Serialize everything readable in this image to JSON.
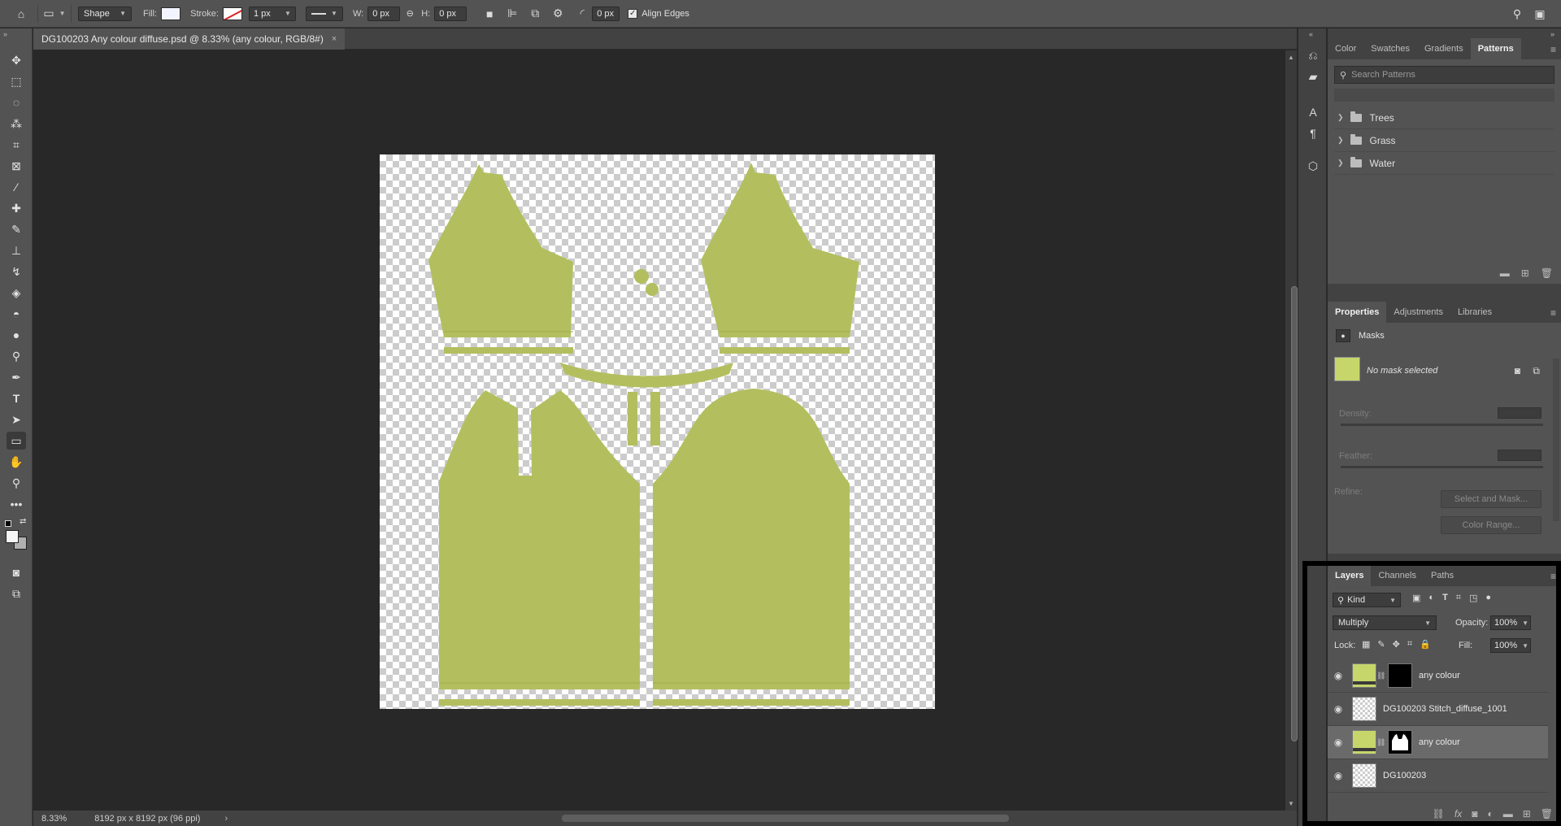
{
  "options_bar": {
    "tool_mode": "Shape",
    "fill_label": "Fill:",
    "stroke_label": "Stroke:",
    "stroke_width": "1 px",
    "w_label": "W:",
    "w_value": "0 px",
    "h_label": "H:",
    "h_value": "0 px",
    "corner_radius": "0 px",
    "align_edges_label": "Align Edges",
    "align_edges_checked": true
  },
  "document": {
    "tab_title": "DG100203 Any colour diffuse.psd @ 8.33% (any colour, RGB/8#)",
    "close_glyph": "×"
  },
  "status": {
    "zoom": "8.33%",
    "doc_size": "8192 px x 8192 px (96 ppi)",
    "arrow": "›"
  },
  "patterns_panel": {
    "tabs": [
      "Color",
      "Swatches",
      "Gradients",
      "Patterns"
    ],
    "active_tab": "Patterns",
    "search_placeholder": "Search Patterns",
    "groups": [
      "Trees",
      "Grass",
      "Water"
    ]
  },
  "properties_panel": {
    "tabs": [
      "Properties",
      "Adjustments",
      "Libraries"
    ],
    "active_tab": "Properties",
    "section": "Masks",
    "mask_status": "No mask selected",
    "density_label": "Density:",
    "feather_label": "Feather:",
    "refine_label": "Refine:",
    "select_mask_button": "Select and Mask...",
    "color_range_button": "Color Range..."
  },
  "layers_panel": {
    "tabs": [
      "Layers",
      "Channels",
      "Paths"
    ],
    "active_tab": "Layers",
    "filter_kind": "Kind",
    "blend_mode": "Multiply",
    "opacity_label": "Opacity:",
    "opacity_value": "100%",
    "lock_label": "Lock:",
    "fill_label": "Fill:",
    "fill_value": "100%",
    "layers": [
      {
        "name": "any colour",
        "visible": true,
        "selected": false,
        "thumb": "green",
        "mask": "black"
      },
      {
        "name": "DG100203 Stitch_diffuse_1001",
        "visible": true,
        "selected": false,
        "thumb": "checker",
        "mask": null
      },
      {
        "name": "any colour",
        "visible": true,
        "selected": true,
        "thumb": "green",
        "mask": "silhouette"
      },
      {
        "name": "DG100203",
        "visible": true,
        "selected": false,
        "thumb": "checker",
        "mask": null
      }
    ]
  },
  "colors": {
    "garment_fill": "#b3bf5f",
    "app_bg": "#282828",
    "panel_bg": "#535353"
  }
}
